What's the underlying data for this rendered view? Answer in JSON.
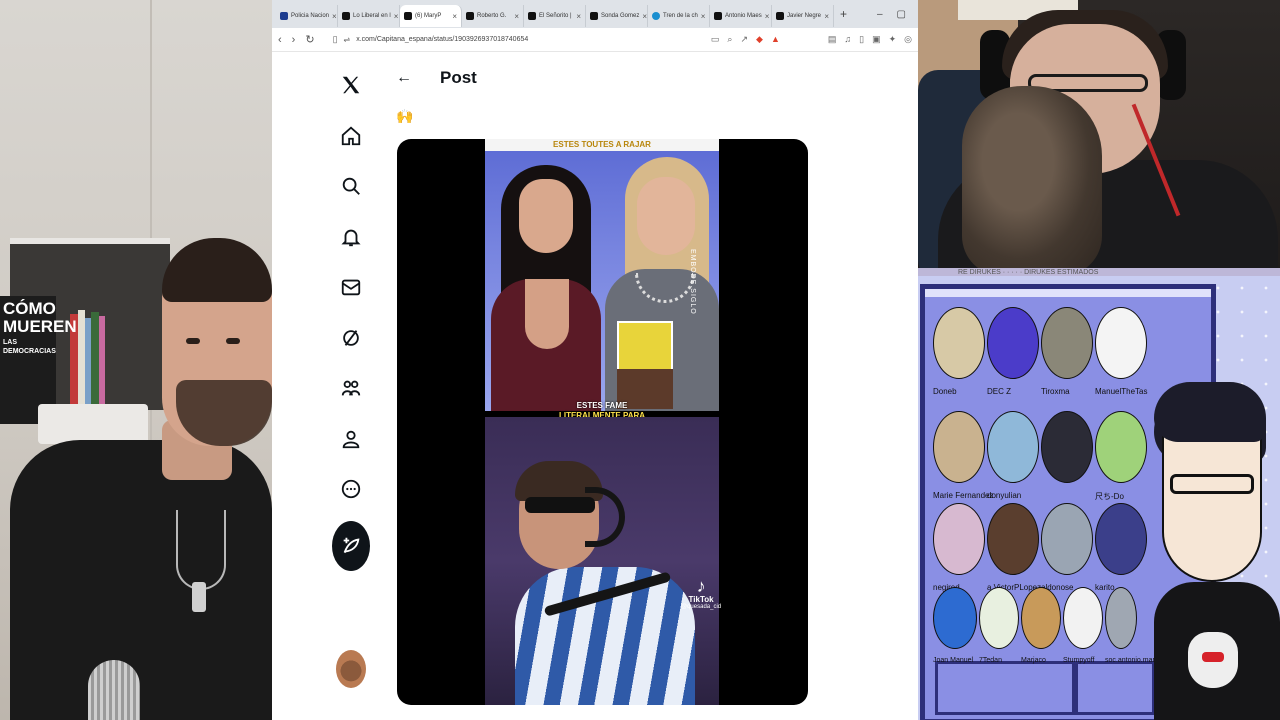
{
  "browser": {
    "tabs": [
      {
        "label": "Policia Nacion"
      },
      {
        "label": "Lo Liberal en l"
      },
      {
        "label": "(6) MaryP"
      },
      {
        "label": "Roberto G."
      },
      {
        "label": "El Señorito | "
      },
      {
        "label": "Sonda Gomez"
      },
      {
        "label": "Tren de la ch"
      },
      {
        "label": "Antonio Maes"
      },
      {
        "label": "Javier Negre"
      }
    ],
    "active_tab_index": 2,
    "url": "x.com/Capitana_espana/status/1903926937018740654"
  },
  "post": {
    "header_title": "Post",
    "emoji": "🙌",
    "video_caption_top": "ESTES TOUTES A RAJAR",
    "video_caption_mid_1": "ESTES FAME",
    "video_caption_mid_2": "LITERALMENTE PARA",
    "watermark": "EMBODE.SIGLO",
    "tiktok_label": "TikTok",
    "tiktok_handle": "@quesada_cid"
  },
  "book": {
    "title": "CÓMO MUEREN",
    "subtitle": "LAS DEMOCRACIAS"
  },
  "cam_strip": "RE DIRUKES · · · · · DIRUKES ESTIMADOS",
  "overlay": {
    "users": [
      {
        "name": "Doneb",
        "color": "#d7c9a6"
      },
      {
        "name": "DEC Z",
        "color": "#4b3cc9"
      },
      {
        "name": "Tiroxma",
        "color": "#8a8778"
      },
      {
        "name": "ManuelTheTas",
        "color": "#f4f4f4"
      },
      {
        "name": "Marie Fernandez",
        "color": "#c9b28f"
      },
      {
        "name": "donyulian",
        "color": "#8fb8d9"
      },
      {
        "name": "",
        "color": "#2b2b36"
      },
      {
        "name": "尺ち-Do",
        "color": "#9fd27a"
      },
      {
        "name": "negired",
        "color": "#d7b9d0"
      },
      {
        "name": "a.VictorPLopez",
        "color": "#5a3e2e"
      },
      {
        "name": "aldonose",
        "color": "#9aa5b3"
      },
      {
        "name": "karito",
        "color": "#3b3f8a"
      },
      {
        "name": "Joan Manuel",
        "color": "#2d6bd1"
      },
      {
        "name": "7Tedan",
        "color": "#e8f0e0"
      },
      {
        "name": "Marjaco",
        "color": "#c89a5a"
      },
      {
        "name": "Stumpyoff",
        "color": "#f2f2f2"
      },
      {
        "name": "soc.antonio.marin",
        "color": "#9fa7b2"
      }
    ]
  }
}
